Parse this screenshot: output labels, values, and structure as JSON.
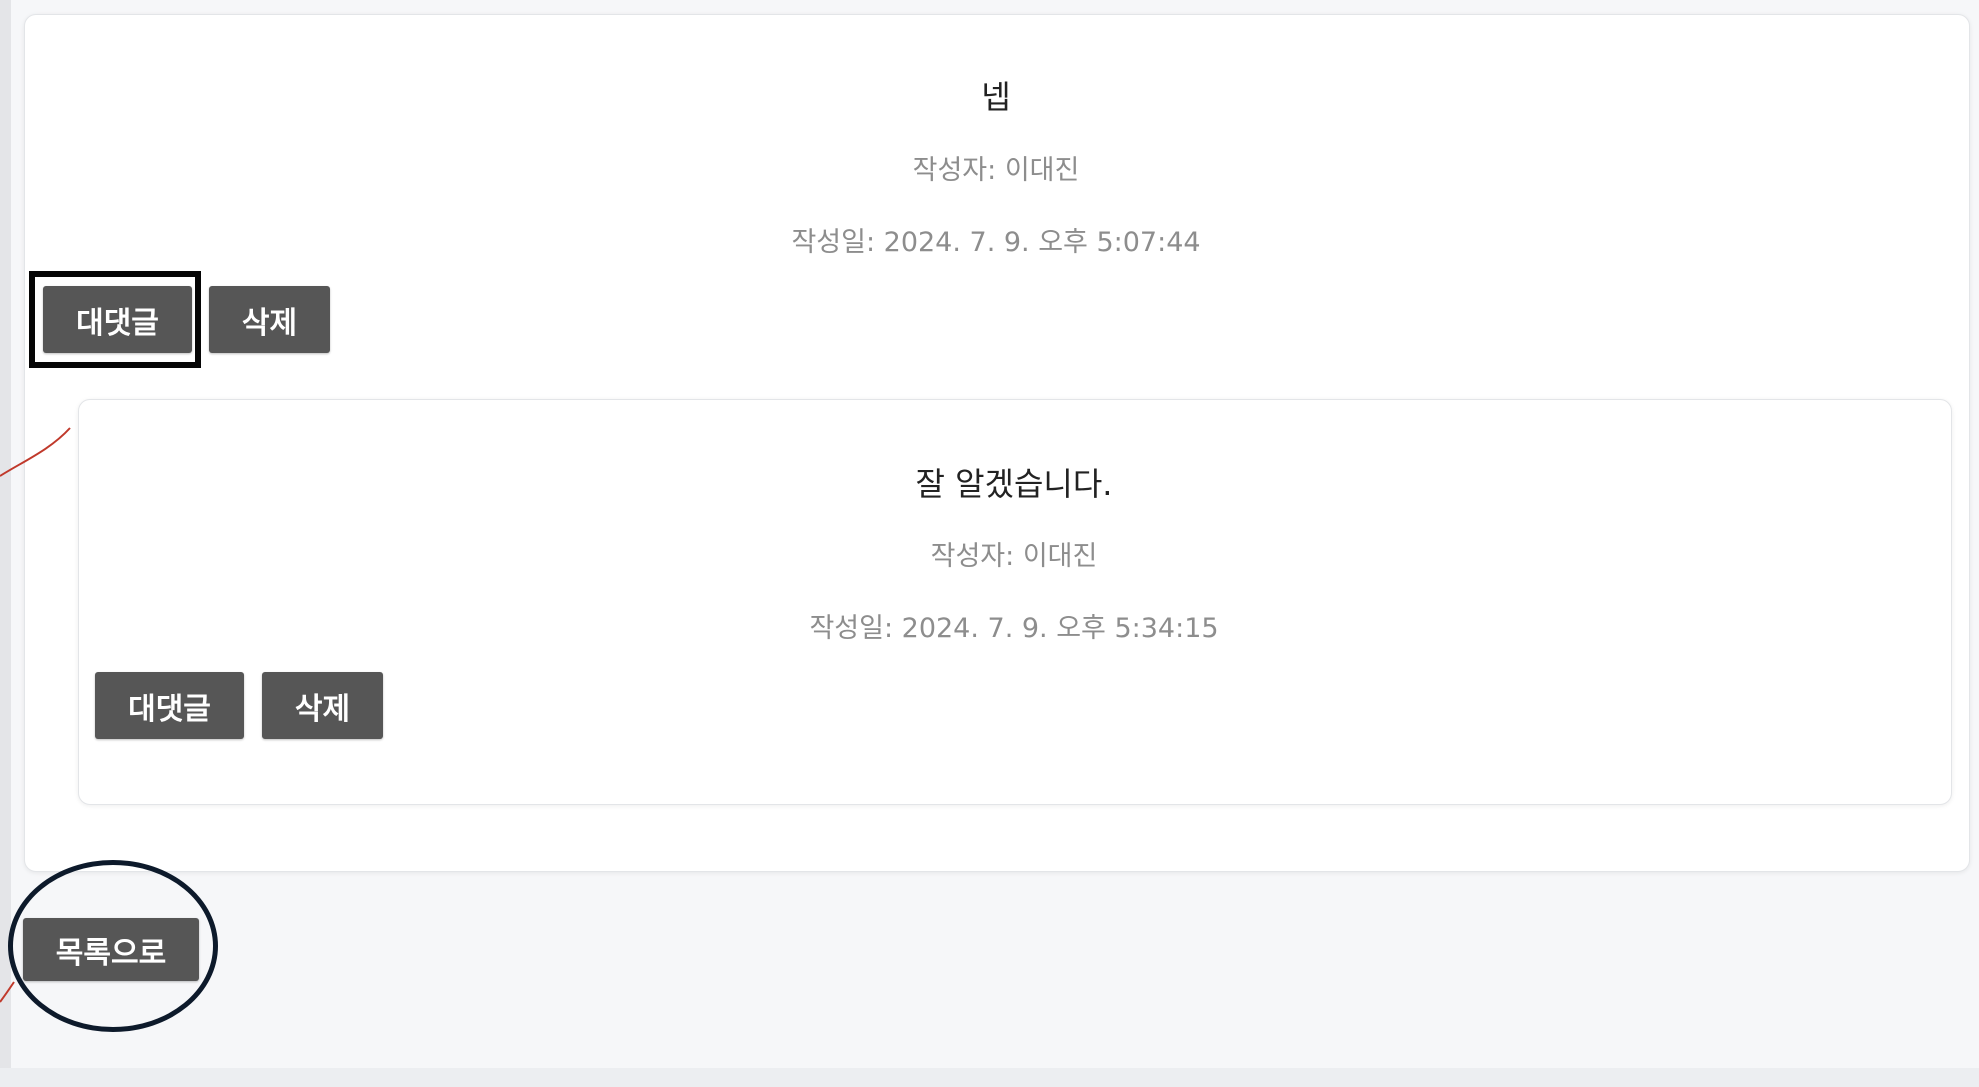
{
  "comments": [
    {
      "body": "넵",
      "author_line": "작성자: 이대진",
      "date_line": "작성일: 2024. 7. 9. 오후 5:07:44",
      "reply_label": "대댓글",
      "delete_label": "삭제"
    },
    {
      "body": "잘 알겠습니다.",
      "author_line": "작성자: 이대진",
      "date_line": "작성일: 2024. 7. 9. 오후 5:34:15",
      "reply_label": "대댓글",
      "delete_label": "삭제"
    }
  ],
  "footer": {
    "back_to_list_label": "목록으로"
  },
  "colors": {
    "button_bg": "#565656",
    "button_text": "#ffffff",
    "page_bg": "#f6f7f9",
    "card_bg": "#ffffff",
    "annotation_dark": "#050505",
    "annotation_red": "#c0392b"
  }
}
